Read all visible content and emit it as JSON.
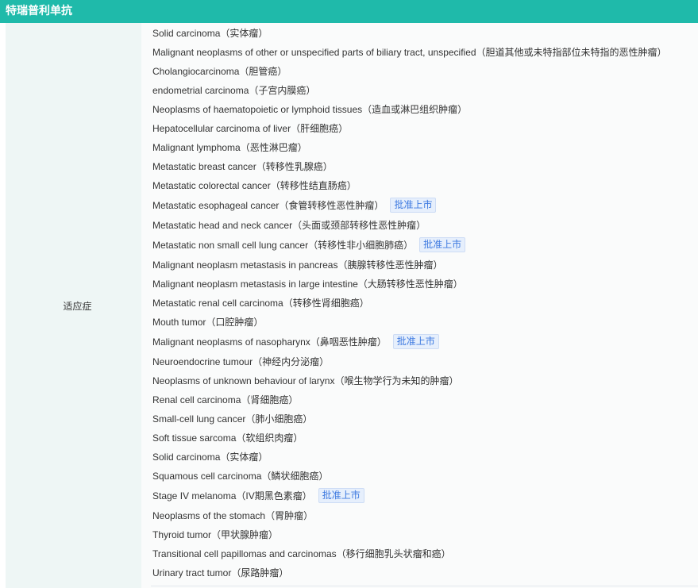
{
  "header": {
    "title": "特瑞普利单抗"
  },
  "label": "适应症",
  "badge_text": "批准上市",
  "colors": {
    "header": "#1fbaaa",
    "badge": "#3e7ae0"
  },
  "indications": [
    {
      "text": "Solid carcinoma（实体瘤）",
      "approved": false
    },
    {
      "text": "Malignant neoplasms of other or unspecified parts of biliary tract, unspecified（胆道其他或未特指部位未特指的恶性肿瘤）",
      "approved": false
    },
    {
      "text": "Cholangiocarcinoma（胆管癌）",
      "approved": false
    },
    {
      "text": "endometrial carcinoma（子宫内膜癌）",
      "approved": false
    },
    {
      "text": "Neoplasms of haematopoietic or lymphoid tissues（造血或淋巴组织肿瘤）",
      "approved": false
    },
    {
      "text": "Hepatocellular carcinoma of liver（肝细胞癌）",
      "approved": false
    },
    {
      "text": "Malignant lymphoma（恶性淋巴瘤）",
      "approved": false
    },
    {
      "text": "Metastatic breast cancer（转移性乳腺癌）",
      "approved": false
    },
    {
      "text": "Metastatic colorectal cancer（转移性结直肠癌）",
      "approved": false
    },
    {
      "text": "Metastatic esophageal cancer（食管转移性恶性肿瘤）",
      "approved": true
    },
    {
      "text": "Metastatic head and neck cancer（头面或颈部转移性恶性肿瘤）",
      "approved": false
    },
    {
      "text": "Metastatic non small cell lung cancer（转移性非小细胞肺癌）",
      "approved": true
    },
    {
      "text": "Malignant neoplasm metastasis in pancreas（胰腺转移性恶性肿瘤）",
      "approved": false
    },
    {
      "text": "Malignant neoplasm metastasis in large intestine（大肠转移性恶性肿瘤）",
      "approved": false
    },
    {
      "text": "Metastatic renal cell carcinoma（转移性肾细胞癌）",
      "approved": false
    },
    {
      "text": "Mouth tumor（口腔肿瘤）",
      "approved": false
    },
    {
      "text": "Malignant neoplasms of nasopharynx（鼻咽恶性肿瘤）",
      "approved": true
    },
    {
      "text": "Neuroendocrine tumour（神经内分泌瘤）",
      "approved": false
    },
    {
      "text": "Neoplasms of unknown behaviour of larynx（喉生物学行为未知的肿瘤）",
      "approved": false
    },
    {
      "text": "Renal cell carcinoma（肾细胞癌）",
      "approved": false
    },
    {
      "text": "Small-cell lung cancer（肺小细胞癌）",
      "approved": false
    },
    {
      "text": "Soft tissue sarcoma（软组织肉瘤）",
      "approved": false
    },
    {
      "text": "Solid carcinoma（实体瘤）",
      "approved": false
    },
    {
      "text": "Squamous cell carcinoma（鳞状细胞癌）",
      "approved": false
    },
    {
      "text": "Stage IV melanoma（IV期黑色素瘤）",
      "approved": true
    },
    {
      "text": "Neoplasms of the stomach（胃肿瘤）",
      "approved": false
    },
    {
      "text": "Thyroid tumor（甲状腺肿瘤）",
      "approved": false
    },
    {
      "text": "Transitional cell papillomas and carcinomas（移行细胞乳头状瘤和癌）",
      "approved": false
    },
    {
      "text": "Urinary tract tumor（尿路肿瘤）",
      "approved": false
    }
  ]
}
